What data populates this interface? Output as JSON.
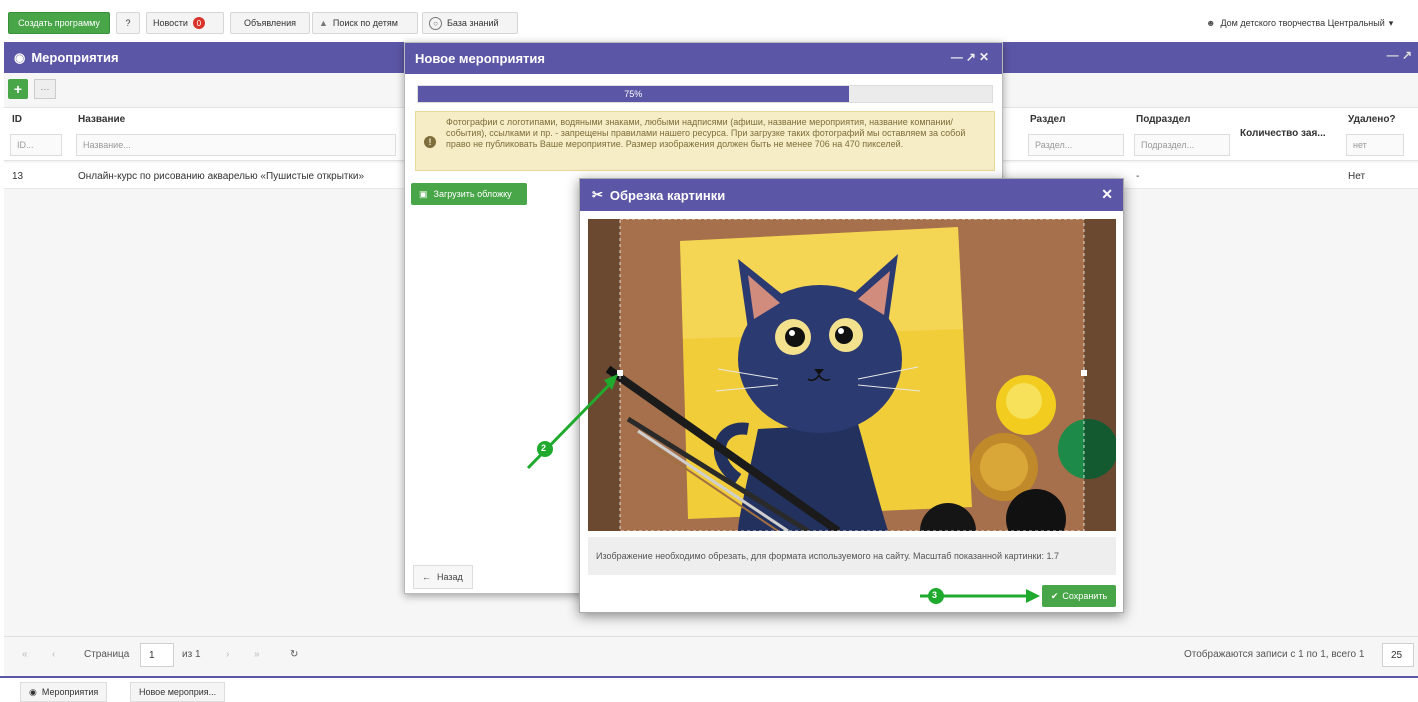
{
  "topbar": {
    "create_program": "Создать программу",
    "news": "Новости",
    "news_count": "0",
    "ads": "Объявления",
    "search_children": "Поиск по детям",
    "knowledge_base": "База знаний",
    "organization": "Дом детского творчества Центральный"
  },
  "main": {
    "title": "Мероприятия",
    "columns": {
      "id": "ID",
      "name": "Название",
      "section": "Раздел",
      "subsection": "Подраздел",
      "requests": "Количество зая...",
      "deleted": "Удалено?"
    },
    "filters": {
      "id": "ID...",
      "name": "Название...",
      "section": "Раздел...",
      "subsection": "Подраздел...",
      "deleted": "нет"
    },
    "rows": [
      {
        "id": "13",
        "name": "Онлайн-курс по рисованию акварелью «Пушистые открытки»",
        "section": "-",
        "deleted": "Нет"
      }
    ],
    "pager": {
      "page_label": "Страница",
      "page": "1",
      "of_label": "из 1",
      "summary": "Отображаются записи с 1 по 1, всего 1",
      "page_size": "25"
    }
  },
  "taskbar": {
    "tab1": "Мероприятия",
    "tab2": "Новое мероприя..."
  },
  "new_event": {
    "title": "Новое мероприятия",
    "progress_text": "75%",
    "progress": 0.75,
    "warning": "Фотографии с логотипами, водяными знаками, любыми надписями (афиши, название мероприятия, название компании/события), ссылками и пр. - запрещены правилами нашего ресурса. При загрузке таких фотографий мы оставляем за собой право не публиковать Ваше мероприятие. Размер изображения должен быть не менее 706 на 470 пикселей.",
    "upload_button": "Загрузить обложку",
    "back_button": "Назад"
  },
  "crop_dialog": {
    "title": "Обрезка картинки",
    "info": "Изображение необходимо обрезать, для формата используемого на сайту. Масштаб показанной картинки: 1.7",
    "save_button": "Сохранить"
  },
  "annotations": {
    "step2": "2",
    "step3": "3"
  },
  "colors": {
    "header": "#5c56a6",
    "green": "#48a548",
    "warning_bg": "#f6edc6"
  }
}
